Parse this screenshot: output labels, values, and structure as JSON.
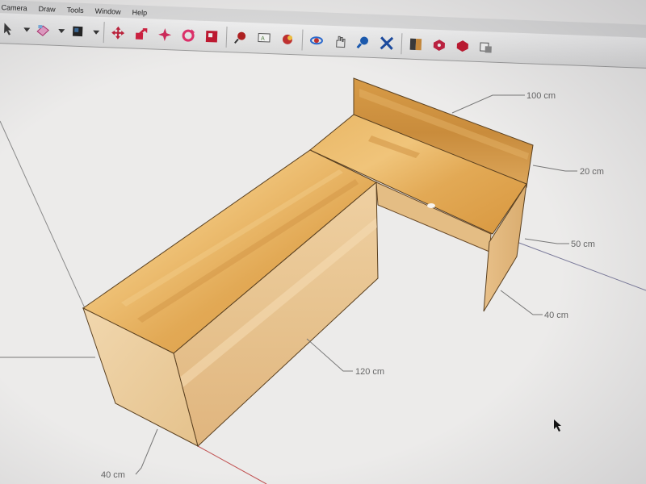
{
  "menu": {
    "items": [
      "Camera",
      "Draw",
      "Tools",
      "Window",
      "Help"
    ]
  },
  "toolbar": {
    "buttons": [
      {
        "name": "select-arrow-icon",
        "color": "#3a3a3a"
      },
      {
        "name": "dropdown-chevron-icon",
        "color": "#333333"
      },
      {
        "name": "eraser-icon",
        "color": "#d14b8f"
      },
      {
        "name": "dropdown-chevron-icon",
        "color": "#333333"
      },
      {
        "name": "paint-bucket-icon",
        "color": "#2b2b2b"
      },
      {
        "name": "dropdown-chevron-icon",
        "color": "#333333"
      },
      {
        "name": "move-icon",
        "color": "#c0203a"
      },
      {
        "name": "push-pull-icon",
        "color": "#d02040"
      },
      {
        "name": "rotate-icon",
        "color": "#d02a5a"
      },
      {
        "name": "follow-me-icon",
        "color": "#e0306a"
      },
      {
        "name": "scale-icon",
        "color": "#c01830"
      },
      {
        "name": "tape-measure-icon",
        "color": "#b02020"
      },
      {
        "name": "text-icon",
        "color": "#4a7a3a"
      },
      {
        "name": "axes-icon",
        "color": "#c03030"
      },
      {
        "name": "orbit-icon",
        "color": "#2a6ad0"
      },
      {
        "name": "pan-icon",
        "color": "#5a5a5a"
      },
      {
        "name": "zoom-icon",
        "color": "#1a5ab0"
      },
      {
        "name": "zoom-extents-icon",
        "color": "#1a4aa0"
      },
      {
        "name": "section-plane-icon",
        "color": "#3a3a3a"
      },
      {
        "name": "model-info-icon",
        "color": "#c02040"
      },
      {
        "name": "materials-icon",
        "color": "#c01830"
      },
      {
        "name": "components-icon",
        "color": "#555555"
      }
    ]
  },
  "model": {
    "wood_light": "#e8b468",
    "wood_mid": "#d79a4a",
    "wood_side": "#f0d0a0",
    "dimensions": {
      "backrest_length": "100 cm",
      "backrest_height": "20 cm",
      "seat_depth": "50 cm",
      "leg_width": "40 cm",
      "bench_length": "120 cm",
      "bench_width": "40 cm"
    }
  }
}
